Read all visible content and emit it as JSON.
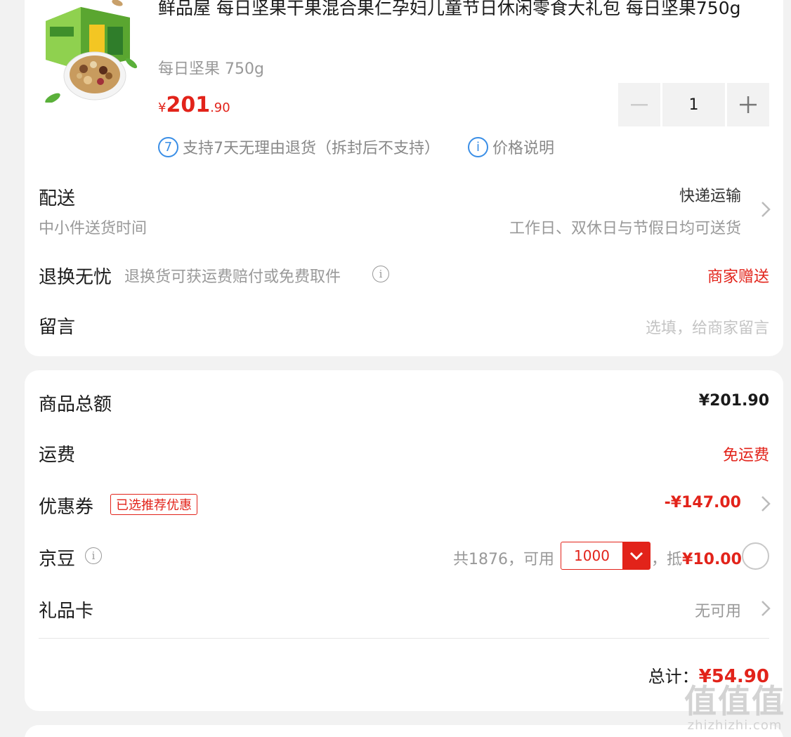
{
  "product": {
    "title": "鲜品屋 每日坚果干果混合果仁孕妇儿童节日休闲零食大礼包 每日坚果750g",
    "spec": "每日坚果 750g",
    "price_currency": "¥",
    "price_int": "201",
    "price_dec": ".90",
    "quantity": "1",
    "minus_icon": "minus-icon",
    "plus_icon": "plus-icon",
    "return_badge": "7",
    "return_policy": "支持7天无理由退货（拆封后不支持）",
    "price_info_badge": "i",
    "price_info": "价格说明"
  },
  "delivery": {
    "label": "配送",
    "sub": "中小件送货时间",
    "method": "快递运输",
    "schedule": "工作日、双休日与节假日均可送货"
  },
  "return_worry": {
    "label": "退换无忧",
    "desc": "退换货可获运费赔付或免费取件",
    "value": "商家赠送"
  },
  "message": {
    "label": "留言",
    "placeholder": "选填，给商家留言"
  },
  "summary": {
    "goods_total_label": "商品总额",
    "goods_total_value": "¥201.90",
    "shipping_label": "运费",
    "shipping_value": "免运费",
    "coupon_label": "优惠券",
    "coupon_tag": "已选推荐优惠",
    "coupon_value": "-¥147.00",
    "beans_label": "京豆",
    "beans_total": "共1876，可用",
    "beans_select": "1000",
    "beans_offset_prefix": "，抵",
    "beans_offset_value": "¥10.00",
    "giftcard_label": "礼品卡",
    "giftcard_value": "无可用",
    "total_label": "总计：",
    "total_value": "¥54.90"
  },
  "watermark": {
    "big": "值值值",
    "small": "zhizhizhi.com"
  },
  "colors": {
    "accent_red": "#e2231a",
    "info_blue": "#3a8ee6",
    "background": "#f2f2f2"
  }
}
